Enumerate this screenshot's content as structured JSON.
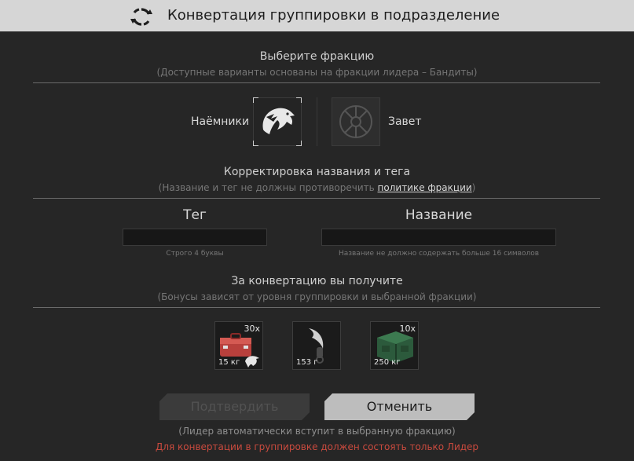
{
  "window": {
    "title": "Конвертация группировки в подразделение",
    "icon": "refresh-icon"
  },
  "faction_section": {
    "heading": "Выберите фракцию",
    "subheading": "(Доступные варианты основаны на фракции лидера – Бандиты)",
    "options": [
      {
        "label": "Наёмники",
        "icon": "eagle-icon",
        "selected": true
      },
      {
        "label": "Завет",
        "icon": "covenant-emblem-icon",
        "selected": false
      }
    ]
  },
  "name_section": {
    "heading": "Корректировка названия и тега",
    "subheading_prefix": "(Название и тег не должны противоречить ",
    "subheading_link": "политике фракции",
    "subheading_suffix": ")",
    "tag": {
      "label": "Тег",
      "value": "",
      "hint": "Строго 4 буквы"
    },
    "name": {
      "label": "Название",
      "value": "",
      "hint": "Название не должно содержать больше 16 символов"
    }
  },
  "rewards_section": {
    "heading": "За конвертацию вы получите",
    "subheading": "(Бонусы зависят от уровня группировки и выбранной фракции)",
    "items": [
      {
        "icon": "red-case-icon",
        "count": "30x",
        "weight": "15 кг"
      },
      {
        "icon": "karambit-knife-icon",
        "count": "",
        "weight": "153 г"
      },
      {
        "icon": "green-crate-icon",
        "count": "10x",
        "weight": "250 кг"
      }
    ]
  },
  "buttons": {
    "confirm": "Подтвердить",
    "cancel": "Отменить",
    "confirm_enabled": false
  },
  "footer": {
    "note": "(Лидер автоматически вступит в выбранную фракцию)",
    "warning": "Для конвертации в группировке должен состоять только Лидер"
  },
  "colors": {
    "titlebar": "#d6d6d6",
    "background": "#262626",
    "warning": "#c94a3e"
  }
}
